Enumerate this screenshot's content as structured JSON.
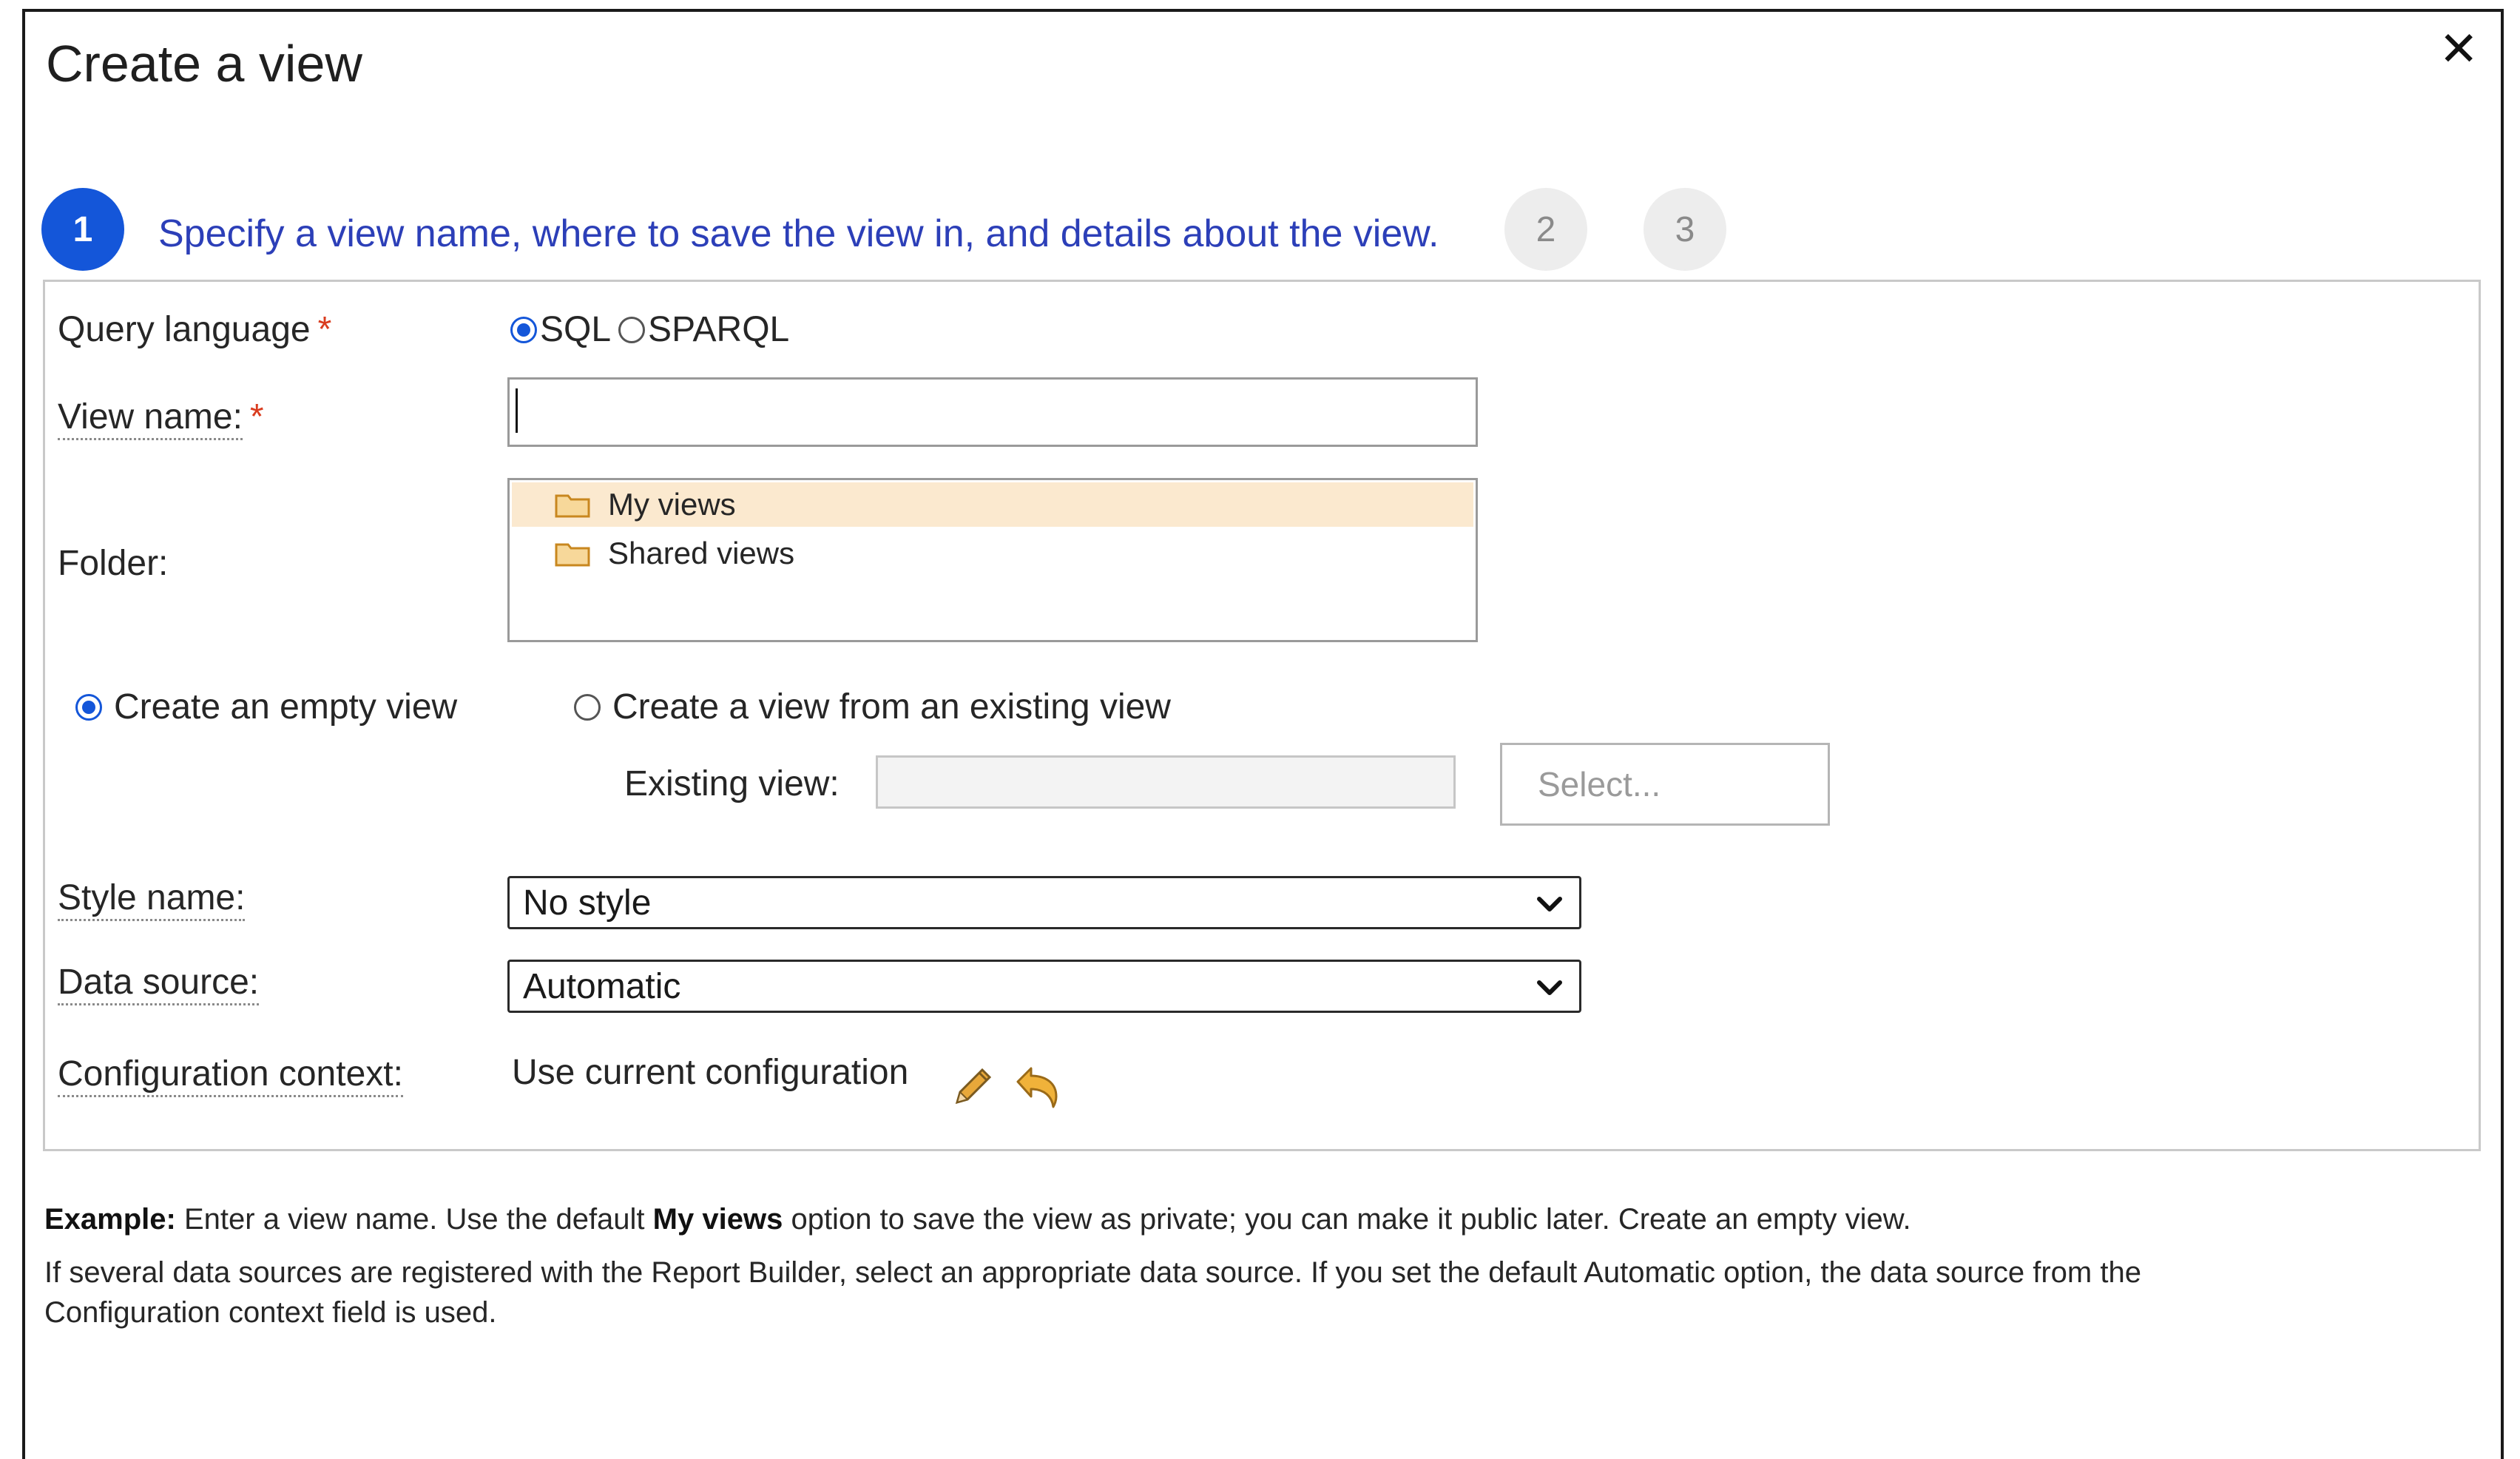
{
  "dialog": {
    "title": "Create a view",
    "close_label": "✕"
  },
  "steps": {
    "current": "1",
    "current_text": "Specify a view name, where to save the view in, and details about the view.",
    "step2": "2",
    "step3": "3"
  },
  "form": {
    "query_language": {
      "label": "Query language",
      "required": "*",
      "options": [
        "SQL",
        "SPARQL"
      ],
      "selected": "SQL"
    },
    "view_name": {
      "label": "View name:",
      "required": "*",
      "value": ""
    },
    "folder": {
      "label": "Folder:",
      "items": [
        "My views",
        "Shared views"
      ],
      "selected": "My views"
    },
    "creation_mode": {
      "empty_label": "Create an empty view",
      "existing_label": "Create a view from an existing view",
      "selected": "Create an empty view"
    },
    "existing_view": {
      "label": "Existing view:",
      "value": "",
      "select_button": "Select..."
    },
    "style_name": {
      "label": "Style name:",
      "value": "No style"
    },
    "data_source": {
      "label": "Data source:",
      "value": "Automatic"
    },
    "configuration_context": {
      "label": "Configuration context:",
      "value": "Use current configuration"
    }
  },
  "help": {
    "example_label": "Example:",
    "example_part1": "Enter a view name. Use the default",
    "example_bold": "My views",
    "example_part2": "option to save the view as private; you can make it public later. Create an empty view.",
    "line2a": "If several data sources are registered with the Report Builder, select an appropriate data source. If you set the default Automatic option, the data source from the",
    "line2b": "Configuration context field is used."
  },
  "colors": {
    "accent": "#1456d9",
    "step_text": "#2c3fb8",
    "required": "#d93c1f",
    "selected_row": "#fbe9cf",
    "folder_icon": "#e8a83a"
  }
}
